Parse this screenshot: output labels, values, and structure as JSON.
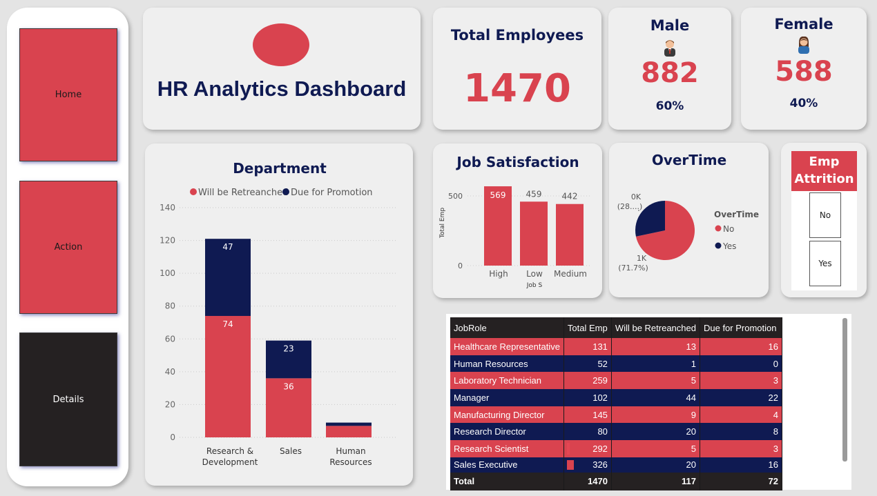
{
  "nav": {
    "home": "Home",
    "action": "Action",
    "details": "Details"
  },
  "header": {
    "title": "HR Analytics Dashboard"
  },
  "kpis": {
    "total": {
      "label": "Total Employees",
      "value": "1470"
    },
    "male": {
      "label": "Male",
      "value": "882",
      "pct": "60%",
      "icon": "male-person-icon"
    },
    "female": {
      "label": "Female",
      "value": "588",
      "pct": "40%",
      "icon": "female-person-icon"
    }
  },
  "colors": {
    "red": "#d9434f",
    "navy": "#0f1a52",
    "dark": "#252122"
  },
  "department_chart": {
    "title": "Department",
    "legend": [
      "Will be Retreanched",
      "Due for Promotion"
    ]
  },
  "job_chart": {
    "title": "Job Satisfaction",
    "ylabel": "Total Emp",
    "xlabel": "Job S"
  },
  "overtime_chart": {
    "title": "OverTime",
    "legend_title": "OverTime",
    "legend": [
      "No",
      "Yes"
    ],
    "label_yes_value": "0K",
    "label_yes_pct": "(28....)",
    "label_no_value": "1K",
    "label_no_pct": "(71.7%)"
  },
  "attrition": {
    "title_line1": "Emp",
    "title_line2": "Attrition",
    "options": [
      "No",
      "Yes"
    ]
  },
  "chart_data": [
    {
      "type": "bar",
      "stacked": true,
      "title": "Department",
      "categories": [
        "Research & Development",
        "Sales",
        "Human Resources"
      ],
      "series": [
        {
          "name": "Will be Retreanched",
          "values": [
            74,
            36,
            7
          ],
          "labels": [
            "74",
            "36",
            ""
          ]
        },
        {
          "name": "Due for Promotion",
          "values": [
            47,
            23,
            2
          ],
          "labels": [
            "47",
            "23",
            ""
          ]
        }
      ],
      "ylim": [
        0,
        140
      ],
      "yticks": [
        "0",
        "20",
        "40",
        "60",
        "80",
        "100",
        "120",
        "140"
      ],
      "xticklabels": [
        [
          "Research &",
          "Development"
        ],
        [
          "Sales"
        ],
        [
          "Human",
          "Resources"
        ]
      ],
      "grid": true,
      "legend_position": "top"
    },
    {
      "type": "bar",
      "title": "Job Satisfaction",
      "categories": [
        "High",
        "Low",
        "Medium"
      ],
      "values": [
        569,
        459,
        442
      ],
      "ylabel": "Total Emp",
      "xlabel": "Job S",
      "ylim": [
        0,
        600
      ],
      "yticks": [
        "0",
        "500"
      ]
    },
    {
      "type": "pie",
      "title": "OverTime",
      "series": [
        {
          "name": "No",
          "value": 71.7
        },
        {
          "name": "Yes",
          "value": 28.3
        }
      ],
      "legend_position": "right"
    },
    {
      "type": "table",
      "columns": [
        "JobRole",
        "Total Emp",
        "Will be Retreanched",
        "Due for Promotion"
      ],
      "rows": [
        [
          "Healthcare Representative",
          "131",
          "13",
          "16"
        ],
        [
          "Human Resources",
          "52",
          "1",
          "0"
        ],
        [
          "Laboratory Technician",
          "259",
          "5",
          "3"
        ],
        [
          "Manager",
          "102",
          "44",
          "22"
        ],
        [
          "Manufacturing Director",
          "145",
          "9",
          "4"
        ],
        [
          "Research Director",
          "80",
          "20",
          "8"
        ],
        [
          "Research Scientist",
          "292",
          "5",
          "3"
        ],
        [
          "Sales Executive",
          "326",
          "20",
          "16"
        ]
      ],
      "total": [
        "Total",
        "1470",
        "117",
        "72"
      ]
    }
  ]
}
